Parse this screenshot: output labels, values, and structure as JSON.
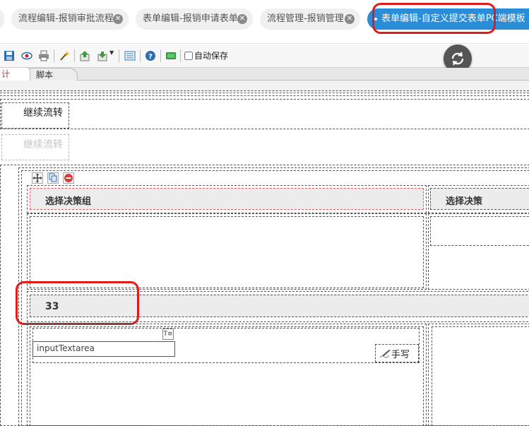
{
  "tabs": [
    {
      "label": "流程编辑-报销审批流程",
      "active": false
    },
    {
      "label": "表单编辑-报销申请表单",
      "active": false
    },
    {
      "label": "流程管理-报销管理",
      "active": false
    },
    {
      "label": "表单编辑-自定义提交表单PC端模板",
      "active": true
    }
  ],
  "toolbar": {
    "icons": [
      "save-icon",
      "preview-eye-icon",
      "print-icon",
      "magic-wand-icon",
      "import-icon",
      "export-icon",
      "list-icon",
      "help-icon",
      "publish-icon"
    ],
    "autosave_label": "自动保存",
    "autosave_checked": false
  },
  "subtabs": {
    "design_label": "计",
    "script_label": "脚本"
  },
  "form": {
    "continue_label": "继续流转",
    "continue_label_disabled": "继续流转",
    "decision_group_header": "选择决策组",
    "decision_header": "选择决策",
    "section_value": "33",
    "textarea_placeholder": "inputTextarea",
    "handwrite_label": "手写"
  },
  "colors": {
    "accent": "#2a8dd8",
    "callout": "#e11a1a"
  }
}
